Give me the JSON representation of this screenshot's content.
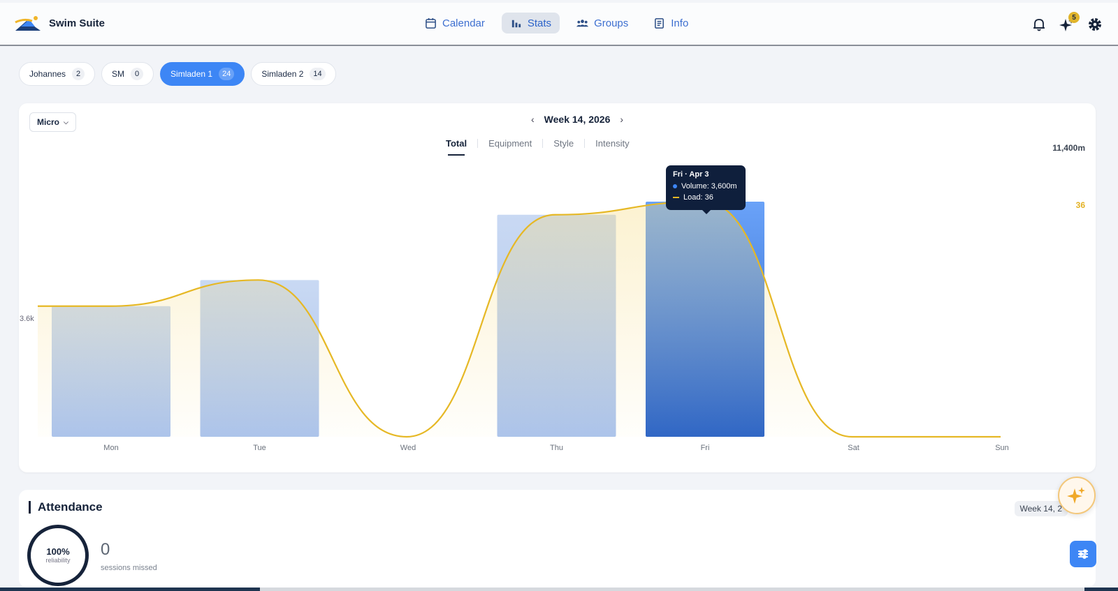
{
  "app": {
    "name": "Swim Suite"
  },
  "nav": [
    {
      "label": "Calendar",
      "icon": "calendar-icon",
      "active": false
    },
    {
      "label": "Stats",
      "icon": "bar-chart-icon",
      "active": true
    },
    {
      "label": "Groups",
      "icon": "groups-icon",
      "active": false
    },
    {
      "label": "Info",
      "icon": "document-icon",
      "active": false
    }
  ],
  "top_icons": {
    "notifications": "bell-icon",
    "ai": "sparkle-icon",
    "ai_badge": "5",
    "settings": "gear-icon"
  },
  "groups": [
    {
      "name": "Johannes",
      "count": "2"
    },
    {
      "name": "SM",
      "count": "0"
    },
    {
      "name": "Simladen 1",
      "count": "24",
      "active": true
    },
    {
      "name": "Simladen 2",
      "count": "14"
    }
  ],
  "chart_card": {
    "period": "Micro",
    "week": "Week 14, 2026",
    "tabs": [
      "Total",
      "Equipment",
      "Style",
      "Intensity"
    ],
    "active_tab": "Total",
    "max_label": "11,400m",
    "load_label": "36",
    "ytick": "3.6k"
  },
  "tooltip": {
    "title": "Fri · Apr 3",
    "volume": "Volume: 3,600m",
    "load": "Load: 36"
  },
  "chart_data": {
    "type": "bar",
    "categories": [
      "Mon",
      "Tue",
      "Wed",
      "Thu",
      "Fri",
      "Sat",
      "Sun"
    ],
    "series": [
      {
        "name": "Volume",
        "unit": "m",
        "values": [
          2000,
          2400,
          0,
          3400,
          3600,
          0,
          0
        ]
      },
      {
        "name": "Load",
        "type": "line",
        "values": [
          20,
          24,
          0,
          34,
          36,
          0,
          0
        ]
      }
    ],
    "highlighted": "Fri",
    "colors": {
      "bar": "#b3c9ef",
      "bar_active": "#3d86f5",
      "line": "#e6b825"
    }
  },
  "attendance": {
    "title": "Attendance",
    "week": "Week 14, 2",
    "reliability_pct": "100%",
    "reliability_label": "reliability",
    "missed": "0",
    "missed_label": "sessions missed"
  }
}
